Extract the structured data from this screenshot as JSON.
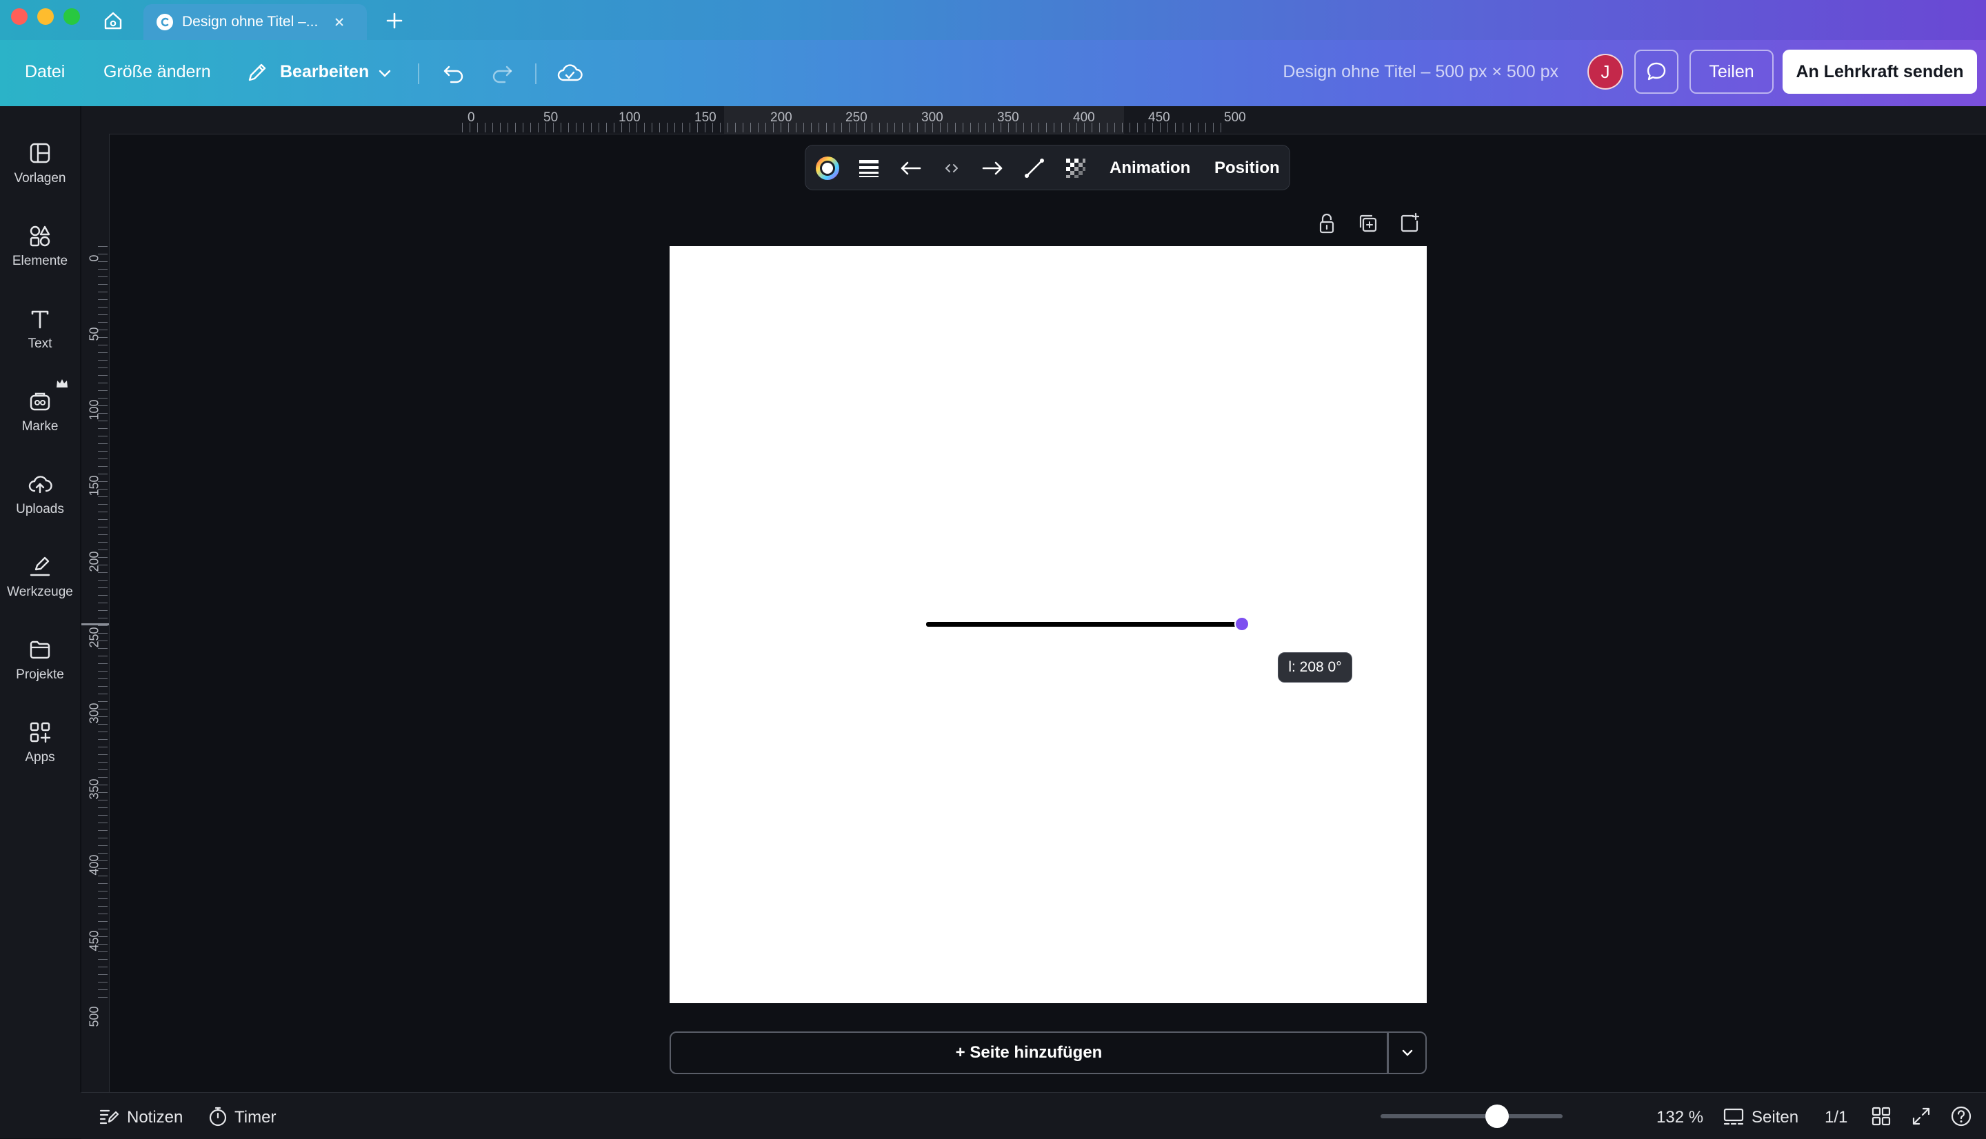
{
  "tab": {
    "title": "Design ohne Titel –..."
  },
  "toolbar": {
    "file": "Datei",
    "resize": "Größe ändern",
    "edit": "Bearbeiten",
    "design_title": "Design ohne Titel – 500 px × 500 px",
    "avatar_initial": "J",
    "share": "Teilen",
    "send": "An Lehrkraft senden"
  },
  "sidebar": {
    "items": [
      {
        "label": "Vorlagen",
        "icon": "templates-icon"
      },
      {
        "label": "Elemente",
        "icon": "elements-icon"
      },
      {
        "label": "Text",
        "icon": "text-icon"
      },
      {
        "label": "Marke",
        "icon": "brand-icon"
      },
      {
        "label": "Uploads",
        "icon": "upload-cloud-icon"
      },
      {
        "label": "Werkzeuge",
        "icon": "draw-tools-icon"
      },
      {
        "label": "Projekte",
        "icon": "folder-icon"
      },
      {
        "label": "Apps",
        "icon": "apps-icon"
      }
    ]
  },
  "rulers": {
    "top": [
      "0",
      "50",
      "100",
      "150",
      "200",
      "250",
      "300",
      "350",
      "400",
      "450",
      "500"
    ],
    "left": [
      "0",
      "50",
      "100",
      "150",
      "200",
      "250",
      "300",
      "350",
      "400",
      "450",
      "500"
    ]
  },
  "context_bar": {
    "animation": "Animation",
    "position": "Position"
  },
  "canvas": {
    "measure": "l: 208 0°"
  },
  "add_page": {
    "label": "+ Seite hinzufügen"
  },
  "bottom": {
    "notes": "Notizen",
    "timer": "Timer",
    "zoom": "132 %",
    "zoom_level": 0.64,
    "pages": "Seiten",
    "page_count": "1/1"
  },
  "colors": {
    "accent_handle": "#7d4ff0",
    "avatar": "#c4284a",
    "background": "#0e1015"
  }
}
